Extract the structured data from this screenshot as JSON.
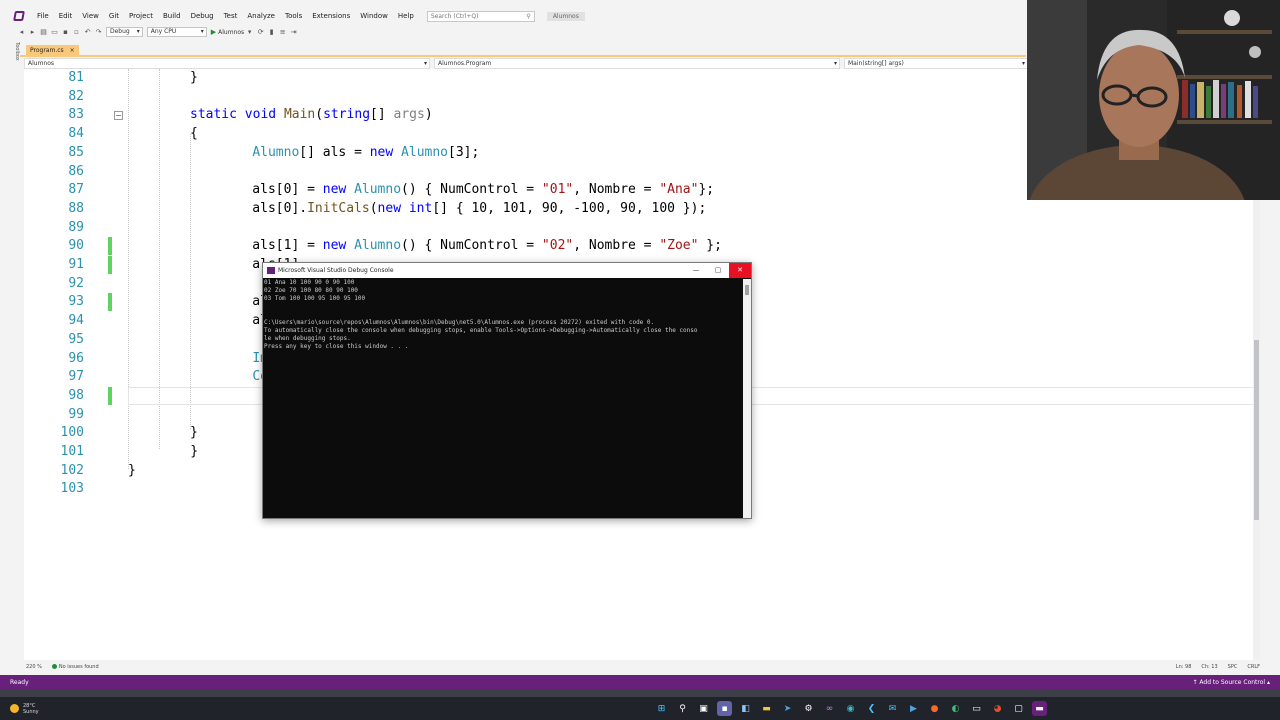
{
  "menu": {
    "items": [
      "File",
      "Edit",
      "View",
      "Git",
      "Project",
      "Build",
      "Debug",
      "Test",
      "Analyze",
      "Tools",
      "Extensions",
      "Window",
      "Help"
    ],
    "search_placeholder": "Search (Ctrl+Q)",
    "solution_name": "Alumnos"
  },
  "toolbar": {
    "config": "Debug",
    "platform": "Any CPU",
    "run_label": "Alumnos"
  },
  "sidebar": {
    "toolbox": "Toolbox"
  },
  "tabs": [
    {
      "label": "Program.cs",
      "close": "×"
    }
  ],
  "nav": {
    "project": "Alumnos",
    "class": "Alumnos.Program",
    "member": "Main(string[] args)"
  },
  "code": {
    "lines": [
      {
        "n": "81",
        "t": "        }"
      },
      {
        "n": "82",
        "t": ""
      },
      {
        "n": "83",
        "t": "        static void Main(string[] args)"
      },
      {
        "n": "84",
        "t": "        {"
      },
      {
        "n": "85",
        "t": "            Alumno[] als = new Alumno[3];"
      },
      {
        "n": "86",
        "t": ""
      },
      {
        "n": "87",
        "t": "            als[0] = new Alumno() { NumControl = \"01\", Nombre = \"Ana\"};"
      },
      {
        "n": "88",
        "t": "            als[0].InitCals(new int[] { 10, 101, 90, -100, 90, 100 });"
      },
      {
        "n": "89",
        "t": ""
      },
      {
        "n": "90",
        "t": "            als[1] = new Alumno() { NumControl = \"02\", Nombre = \"Zoe\" };"
      },
      {
        "n": "91",
        "t": "            als[1]"
      },
      {
        "n": "92",
        "t": ""
      },
      {
        "n": "93",
        "t": "            als[2"
      },
      {
        "n": "94",
        "t": "            als[2"
      },
      {
        "n": "95",
        "t": ""
      },
      {
        "n": "96",
        "t": "            Impri"
      },
      {
        "n": "97",
        "t": "            Consol"
      },
      {
        "n": "98",
        "t": ""
      },
      {
        "n": "99",
        "t": ""
      },
      {
        "n": "100",
        "t": "        }"
      },
      {
        "n": "101",
        "t": "    }"
      },
      {
        "n": "102",
        "t": "}"
      },
      {
        "n": "103",
        "t": ""
      }
    ]
  },
  "editor_status": {
    "zoom": "220 %",
    "issues": "No issues found",
    "position": "Ln: 98",
    "column": "Ch: 13",
    "spc": "SPC",
    "crlf": "CRLF"
  },
  "statusbar": {
    "ready": "Ready",
    "source_control": "Add to Source Control"
  },
  "console": {
    "title": "Microsoft Visual Studio Debug Console",
    "output": "01 Ana 10 100 90 0 90 100\n02 Zoe 70 100 80 80 90 100\n03 Tom 100 100 95 100 95 100\n\n\nC:\\Users\\mario\\source\\repos\\Alumnos\\Alumnos\\bin\\Debug\\net5.0\\Alumnos.exe (process 20272) exited with code 0.\nTo automatically close the console when debugging stops, enable Tools->Options->Debugging->Automatically close the conso\nle when debugging stops.\nPress any key to close this window . . ."
  },
  "taskbar": {
    "temperature": "28°C",
    "condition": "Sunny"
  },
  "colors": {
    "vs_purple": "#68217a",
    "keyword": "#0000ff",
    "type": "#2b91af",
    "string": "#a31515",
    "change_bar": "#5fd35f",
    "tab_active": "#f9c87a"
  }
}
